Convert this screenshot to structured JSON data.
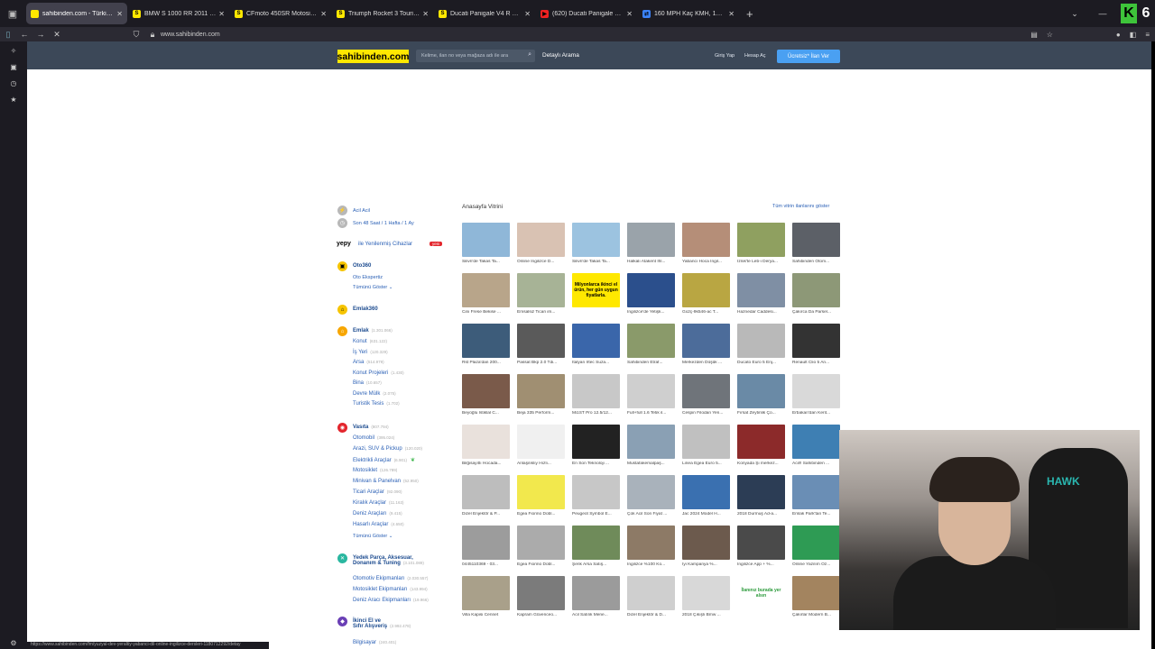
{
  "browser": {
    "tabs": [
      {
        "title": "sahibinden.com - Türkiye'nin Cit",
        "fav": "#ffe800",
        "fav_letter": "",
        "active": true
      },
      {
        "title": "BMW S 1000 RR 2011 Model Sı",
        "fav": "#ffe800",
        "fav_letter": "S"
      },
      {
        "title": "CFmoto 450SR Motosiklet Fiyat",
        "fav": "#ffe800",
        "fav_letter": "S"
      },
      {
        "title": "Triumph Rocket 3 Touring 2015",
        "fav": "#ffe800",
        "fav_letter": "S"
      },
      {
        "title": "Ducati Panigale V4 R 2023 Mod",
        "fav": "#ffe800",
        "fav_letter": "S"
      },
      {
        "title": "(620) Ducati Panigale V4S top sp",
        "fav": "#e22",
        "fav_letter": "▶"
      },
      {
        "title": "160 MPH Kaç KMH, 160 Mil Saa",
        "fav": "#3b82f6",
        "fav_letter": "⇄"
      }
    ],
    "url": "www.sahibinden.com",
    "k_badge": "K",
    "k_count": "6",
    "status_url": "https://www.sahibinden.com/fm/yuzyal-dev-yeraltiy-yabanci-dil-online-ingilizce-dersleri-1180712292/detay"
  },
  "header": {
    "logo": "sahibinden.com",
    "search_placeholder": "Kelime, ilan no veya mağaza adı ile ara",
    "detail_search": "Detaylı Arama",
    "login": "Giriş Yap",
    "register": "Hesap Aç",
    "post_button": "Ücretsiz* İlan Ver"
  },
  "left_menu": {
    "urgent": "Acil Acil",
    "recent": "Son 48 Saat / 1 Hafta / 1 Ay",
    "yepy_logo": "yepy",
    "yepy_text": "ile Yenilenmiş Cihazlar",
    "yepy_badge": "yeni",
    "oto360": "Oto360",
    "oto_expertiz": "Oto Ekspertiz",
    "show_all": "Tümünü Göster",
    "emlak360": "Emlak360",
    "emlak": {
      "label": "Emlak",
      "count": "(1.301.066)"
    },
    "emlak_subs": [
      {
        "label": "Konut",
        "count": "(631.122)"
      },
      {
        "label": "İş Yeri",
        "count": "(120.329)"
      },
      {
        "label": "Arsa",
        "count": "(514.979)"
      },
      {
        "label": "Konut Projeleri",
        "count": "(1.430)"
      },
      {
        "label": "Bina",
        "count": "(10.657)"
      },
      {
        "label": "Devre Mülk",
        "count": "(2.075)"
      },
      {
        "label": "Turistik Tesis",
        "count": "(1.702)"
      }
    ],
    "vasita": {
      "label": "Vasıta",
      "count": "(807.794)"
    },
    "vasita_subs": [
      {
        "label": "Otomobil",
        "count": "(395.024)"
      },
      {
        "label": "Arazi, SUV & Pickup",
        "count": "(120.020)"
      },
      {
        "label": "Elektrikli Araçlar",
        "count": "(6.901)"
      },
      {
        "label": "Motosiklet",
        "count": "(126.789)"
      },
      {
        "label": "Minivan & Panelvan",
        "count": "(52.950)"
      },
      {
        "label": "Ticari Araçlar",
        "count": "(92.090)"
      },
      {
        "label": "Kiralık Araçlar",
        "count": "(11.163)"
      },
      {
        "label": "Deniz Araçları",
        "count": "(9.415)"
      },
      {
        "label": "Hasarlı Araçlar",
        "count": "(4.650)"
      }
    ],
    "vasita_show_all": "Tümünü Göster",
    "yedek": {
      "label1": "Yedek Parça, Aksesuar,",
      "label2": "Donanım & Tuning",
      "count": "(3.101.089)"
    },
    "yedek_subs": [
      {
        "label": "Otomotiv Ekipmanları",
        "count": "(2.030.557)"
      },
      {
        "label": "Motosiklet Ekipmanları",
        "count": "(143.994)"
      },
      {
        "label": "Deniz Aracı Ekipmanları",
        "count": "(19.966)"
      }
    ],
    "ikinci": {
      "label1": "İkinci El ve",
      "label2": "Sıfır Alışveriş",
      "count": "(2.992.478)"
    },
    "ikinci_subs": [
      {
        "label": "Bilgisayar",
        "count": "(240.401)"
      }
    ]
  },
  "showcase": {
    "title": "Anasayfa Vitrini",
    "show_all": "Tüm vitrin ilanlarını göster",
    "items": [
      {
        "cap": "Silivri'de Takas Ta...",
        "color": "#8fb7d8"
      },
      {
        "cap": "Online İngilizce D...",
        "color": "#d9c2b3"
      },
      {
        "cap": "Silivri'de Takas Ta...",
        "color": "#9cc3e0"
      },
      {
        "cap": "Halkalı Atakent Ihl...",
        "color": "#9aa3aa"
      },
      {
        "cap": "Yabancı Hoca İngil...",
        "color": "#b58e78"
      },
      {
        "cap": "İznik'te Leb-i Derya...",
        "color": "#8fa060"
      },
      {
        "cap": "Sahibinden Otom...",
        "color": "#5c6067"
      },
      {
        "cap": "Cini Frese Bekise ...",
        "color": "#b8a58a"
      },
      {
        "cap": "Emsalsiz Ticari im...",
        "color": "#a7b396"
      },
      {
        "cap": "Milyonlarca ikinci el ürün, her gün uygun fiyatlarla.",
        "color": "#ffe800"
      },
      {
        "cap": "İngilizce'de Yetişk...",
        "color": "#2b4f8c"
      },
      {
        "cap": "Gx2ç-9k546-ac T...",
        "color": "#b9a642"
      },
      {
        "cap": "Haznedar Caddesi...",
        "color": "#7f8fa4"
      },
      {
        "cap": "Çakırca Da Parsel...",
        "color": "#8d9877"
      },
      {
        "cap": "Rst Plaza'dan 200...",
        "color": "#3d5c7a"
      },
      {
        "cap": "Passat Bkp 2.0 Tdi...",
        "color": "#5a5a5a"
      },
      {
        "cap": "İtalyan Irtec Suza...",
        "color": "#3a66aa"
      },
      {
        "cap": "Sahibinden Etraf...",
        "color": "#8a9a6a"
      },
      {
        "cap": "Merkezden Düşük ...",
        "color": "#4c6c9a"
      },
      {
        "cap": "Ducato Euro 5 Enj...",
        "color": "#b9b9b9"
      },
      {
        "cap": "Renault Clio 5 An...",
        "color": "#333333"
      },
      {
        "cap": "Beyoğlu İstiklal C...",
        "color": "#7a5a4a"
      },
      {
        "cap": "Beja 335 Perform...",
        "color": "#a08f72"
      },
      {
        "cap": "Mi1ST Pro 12.5/12...",
        "color": "#c8c8c8"
      },
      {
        "cap": "Full+full 1.6 Tetik il...",
        "color": "#cfcfcf"
      },
      {
        "cap": "Cespin Filodan Yen...",
        "color": "#6f747a"
      },
      {
        "cap": "Fırsat Zeytinlik Ço...",
        "color": "#6a8aa6"
      },
      {
        "cap": "Erbakan'dan Kerit...",
        "color": "#d9d9d9"
      },
      {
        "cap": "Bilğisayıtlı Hocada...",
        "color": "#e9e1dc"
      },
      {
        "cap": "Anlaşılıklıy Hızlı...",
        "color": "#f0f0f0"
      },
      {
        "cap": "En Son Teknoloji ...",
        "color": "#222222"
      },
      {
        "cap": "Mustafakemalpaş...",
        "color": "#8aa0b4"
      },
      {
        "cap": "Linea Egea Euro 5...",
        "color": "#c0c0c0"
      },
      {
        "cap": "Konyada Şi merkez...",
        "color": "#8c2a2a"
      },
      {
        "cap": "Acil!! Sahibinden ...",
        "color": "#3e7fb3"
      },
      {
        "cap": "Dizel Enjektör & P...",
        "color": "#bdbdbd"
      },
      {
        "cap": "Egea Fiorino Dobl...",
        "color": "#f2e84d"
      },
      {
        "cap": "Peugeot Symbol E...",
        "color": "#c7c7c7"
      },
      {
        "cap": "Çok Acil Son Fiyat ...",
        "color": "#a9b2bb"
      },
      {
        "cap": "Jac 2024 Model H...",
        "color": "#3a70b0"
      },
      {
        "cap": "2018 Durmuş Ad-a...",
        "color": "#2c3d55"
      },
      {
        "cap": "Emlak Park'tan Te...",
        "color": "#6a8eb5"
      },
      {
        "cap": "0445110369 - 03...",
        "color": "#9c9c9c"
      },
      {
        "cap": "Egea Fiorino Dobl...",
        "color": "#ababab"
      },
      {
        "cap": "Şerik Arsa Satış...",
        "color": "#6f8b5a"
      },
      {
        "cap": "İngilizce %100 Ko...",
        "color": "#8d7a66"
      },
      {
        "cap": "İyi Kampanya %...",
        "color": "#6c5a4d"
      },
      {
        "cap": "İngilizce App + %...",
        "color": "#4a4a4a"
      },
      {
        "cap": "Online Yazılım Öz...",
        "color": "#2e9b54"
      },
      {
        "cap": "Villa Kapisi Cennet",
        "color": "#a9a08a"
      },
      {
        "cap": "Kapram Güvenceo...",
        "color": "#7b7b7b"
      },
      {
        "cap": "Acil Satılık Mene...",
        "color": "#9b9b9b"
      },
      {
        "cap": "Dizel Enjektör & D...",
        "color": "#cfcfcf"
      },
      {
        "cap": "2018 Çıkışlı Bmw ...",
        "color": "#d8d8d8"
      },
      {
        "cap": "İlanınız burada yer alsın",
        "color": "#ffffff"
      },
      {
        "cap": "Çakırlar Modern B...",
        "color": "#a3845f"
      }
    ]
  },
  "webcam": {
    "chair_logo": "HAWK"
  }
}
